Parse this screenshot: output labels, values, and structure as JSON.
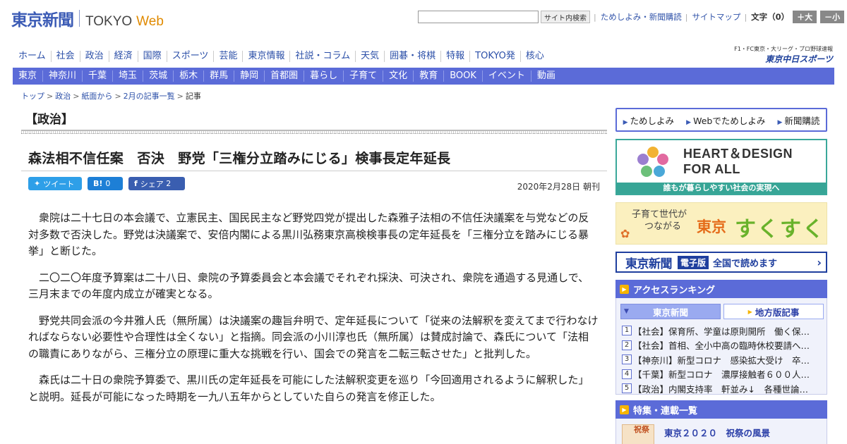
{
  "header": {
    "logo_jp": "東京新聞",
    "logo_en": "TOKYO",
    "logo_web": "Web",
    "search_placeholder": "",
    "search_button": "サイト内検索",
    "link_trial": "ためしよみ・新聞購読",
    "link_sitemap": "サイトマップ",
    "text_size_label": "文字（0）",
    "size_up": "＋大",
    "size_down": "－小"
  },
  "nav_main": [
    "ホーム",
    "社会",
    "政治",
    "経済",
    "国際",
    "スポーツ",
    "芸能",
    "東京情報",
    "社説・コラム",
    "天気",
    "囲碁・将棋",
    "特報",
    "TOKYO発",
    "核心"
  ],
  "chunichi": {
    "small": "F1・FC東京・大リーグ・プロ野球速報",
    "logo": "東京中日スポーツ"
  },
  "nav_region": [
    "東京",
    "神奈川",
    "千葉",
    "埼玉",
    "茨城",
    "栃木",
    "群馬",
    "静岡",
    "首都圏",
    "暮らし",
    "子育て",
    "文化",
    "教育",
    "BOOK",
    "イベント",
    "動画"
  ],
  "breadcrumb": [
    "トップ",
    "政治",
    "紙面から",
    "2月の記事一覧",
    "記事"
  ],
  "article": {
    "section": "【政治】",
    "headline": "森法相不信任案　否決　野党「三権分立踏みにじる」検事長定年延長",
    "tweet": "ツイート",
    "hatena_count": "0",
    "share_label": "シェア",
    "share_count": "2",
    "date": "2020年2月28日 朝刊",
    "paragraphs": [
      "衆院は二十七日の本会議で、立憲民主、国民民主など野党四党が提出した森雅子法相の不信任決議案を与党などの反対多数で否決した。野党は決議案で、安倍内閣による黒川弘務東京高検検事長の定年延長を「三権分立を踏みにじる暴挙」と断じた。",
      "二〇二〇年度予算案は二十八日、衆院の予算委員会と本会議でそれぞれ採決、可決され、衆院を通過する見通しで、三月末までの年度内成立が確実となる。",
      "野党共同会派の今井雅人氏（無所属）は決議案の趣旨弁明で、定年延長について「従来の法解釈を変えてまで行わなければならない必要性や合理性は全くない」と指摘。同会派の小川淳也氏（無所属）は賛成討論で、森氏について「法相の職責にありながら、三権分立の原理に重大な挑戦を行い、国会での発言を二転三転させた」と批判した。",
      "森氏は二十日の衆院予算委で、黒川氏の定年延長を可能にした法解釈変更を巡り「今回適用されるように解釈した」と説明。延長が可能になった時期を一九八五年からとしていた自らの発言を修正した。"
    ]
  },
  "sidebar": {
    "links": [
      "ためしよみ",
      "Webでためしよみ",
      "新聞購読"
    ],
    "heart_line1": "HEART＆DESIGN",
    "heart_line2": "FOR ALL",
    "heart_bar": "誰もが暮らしやすい社会の実現へ",
    "suku_small1": "子育て世代が",
    "suku_small2": "つながる",
    "suku_tokyo": "東京",
    "suku_big": "すくすく",
    "denshi_logo": "東京新聞",
    "denshi_badge": "電子版",
    "denshi_text": "全国で読めます",
    "ranking_title": "アクセスランキング",
    "ranking_tab_active": "東京新聞",
    "ranking_tab_other": "地方版記事",
    "ranking": [
      {
        "num": "1",
        "text": "【社会】保育所、学童は原則開所　働く保…"
      },
      {
        "num": "2",
        "text": "【社会】首相、全小中高の臨時休校要請へ…"
      },
      {
        "num": "3",
        "text": "【神奈川】新型コロナ　感染拡大受け　卒…"
      },
      {
        "num": "4",
        "text": "【千葉】新型コロナ　濃厚接触者６００人…"
      },
      {
        "num": "5",
        "text": "【政治】内閣支持率　軒並み↓　各種世論…"
      }
    ],
    "feature_title": "特集・連載一覧",
    "feature_item": "東京２０２０　祝祭の風景",
    "feature_thumb": "祝祭"
  },
  "colors": {
    "brand_blue": "#3b5bb5",
    "nav_region_bg": "#5b6bd8",
    "web_orange": "#e08a00",
    "heart_green": "#37a596"
  }
}
